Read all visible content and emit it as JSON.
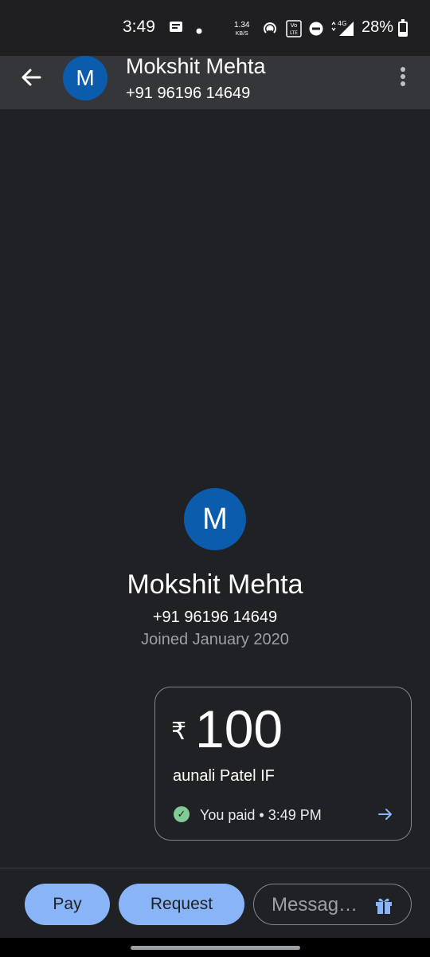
{
  "status_bar": {
    "time": "3:49",
    "net_speed_value": "1.34",
    "net_speed_unit": "KB/S",
    "volte_label": "Vo LTE",
    "network_label": "4G",
    "battery": "28%",
    "battery_level": 0.28
  },
  "header": {
    "avatar_letter": "M",
    "name": "Mokshit Mehta",
    "phone": "+91 96196 14649"
  },
  "profile": {
    "avatar_letter": "M",
    "name": "Mokshit Mehta",
    "phone": "+91 96196 14649",
    "joined": "Joined January 2020"
  },
  "payment": {
    "currency_symbol": "₹",
    "amount": "100",
    "note": "aunali Patel IF",
    "status": "You paid • 3:49 PM",
    "status_color": "#81c995"
  },
  "actions": {
    "pay_label": "Pay",
    "request_label": "Request",
    "message_placeholder": "Messag…"
  },
  "colors": {
    "accent": "#8ab4f8",
    "avatar": "#0b5cad",
    "background": "#202124"
  }
}
